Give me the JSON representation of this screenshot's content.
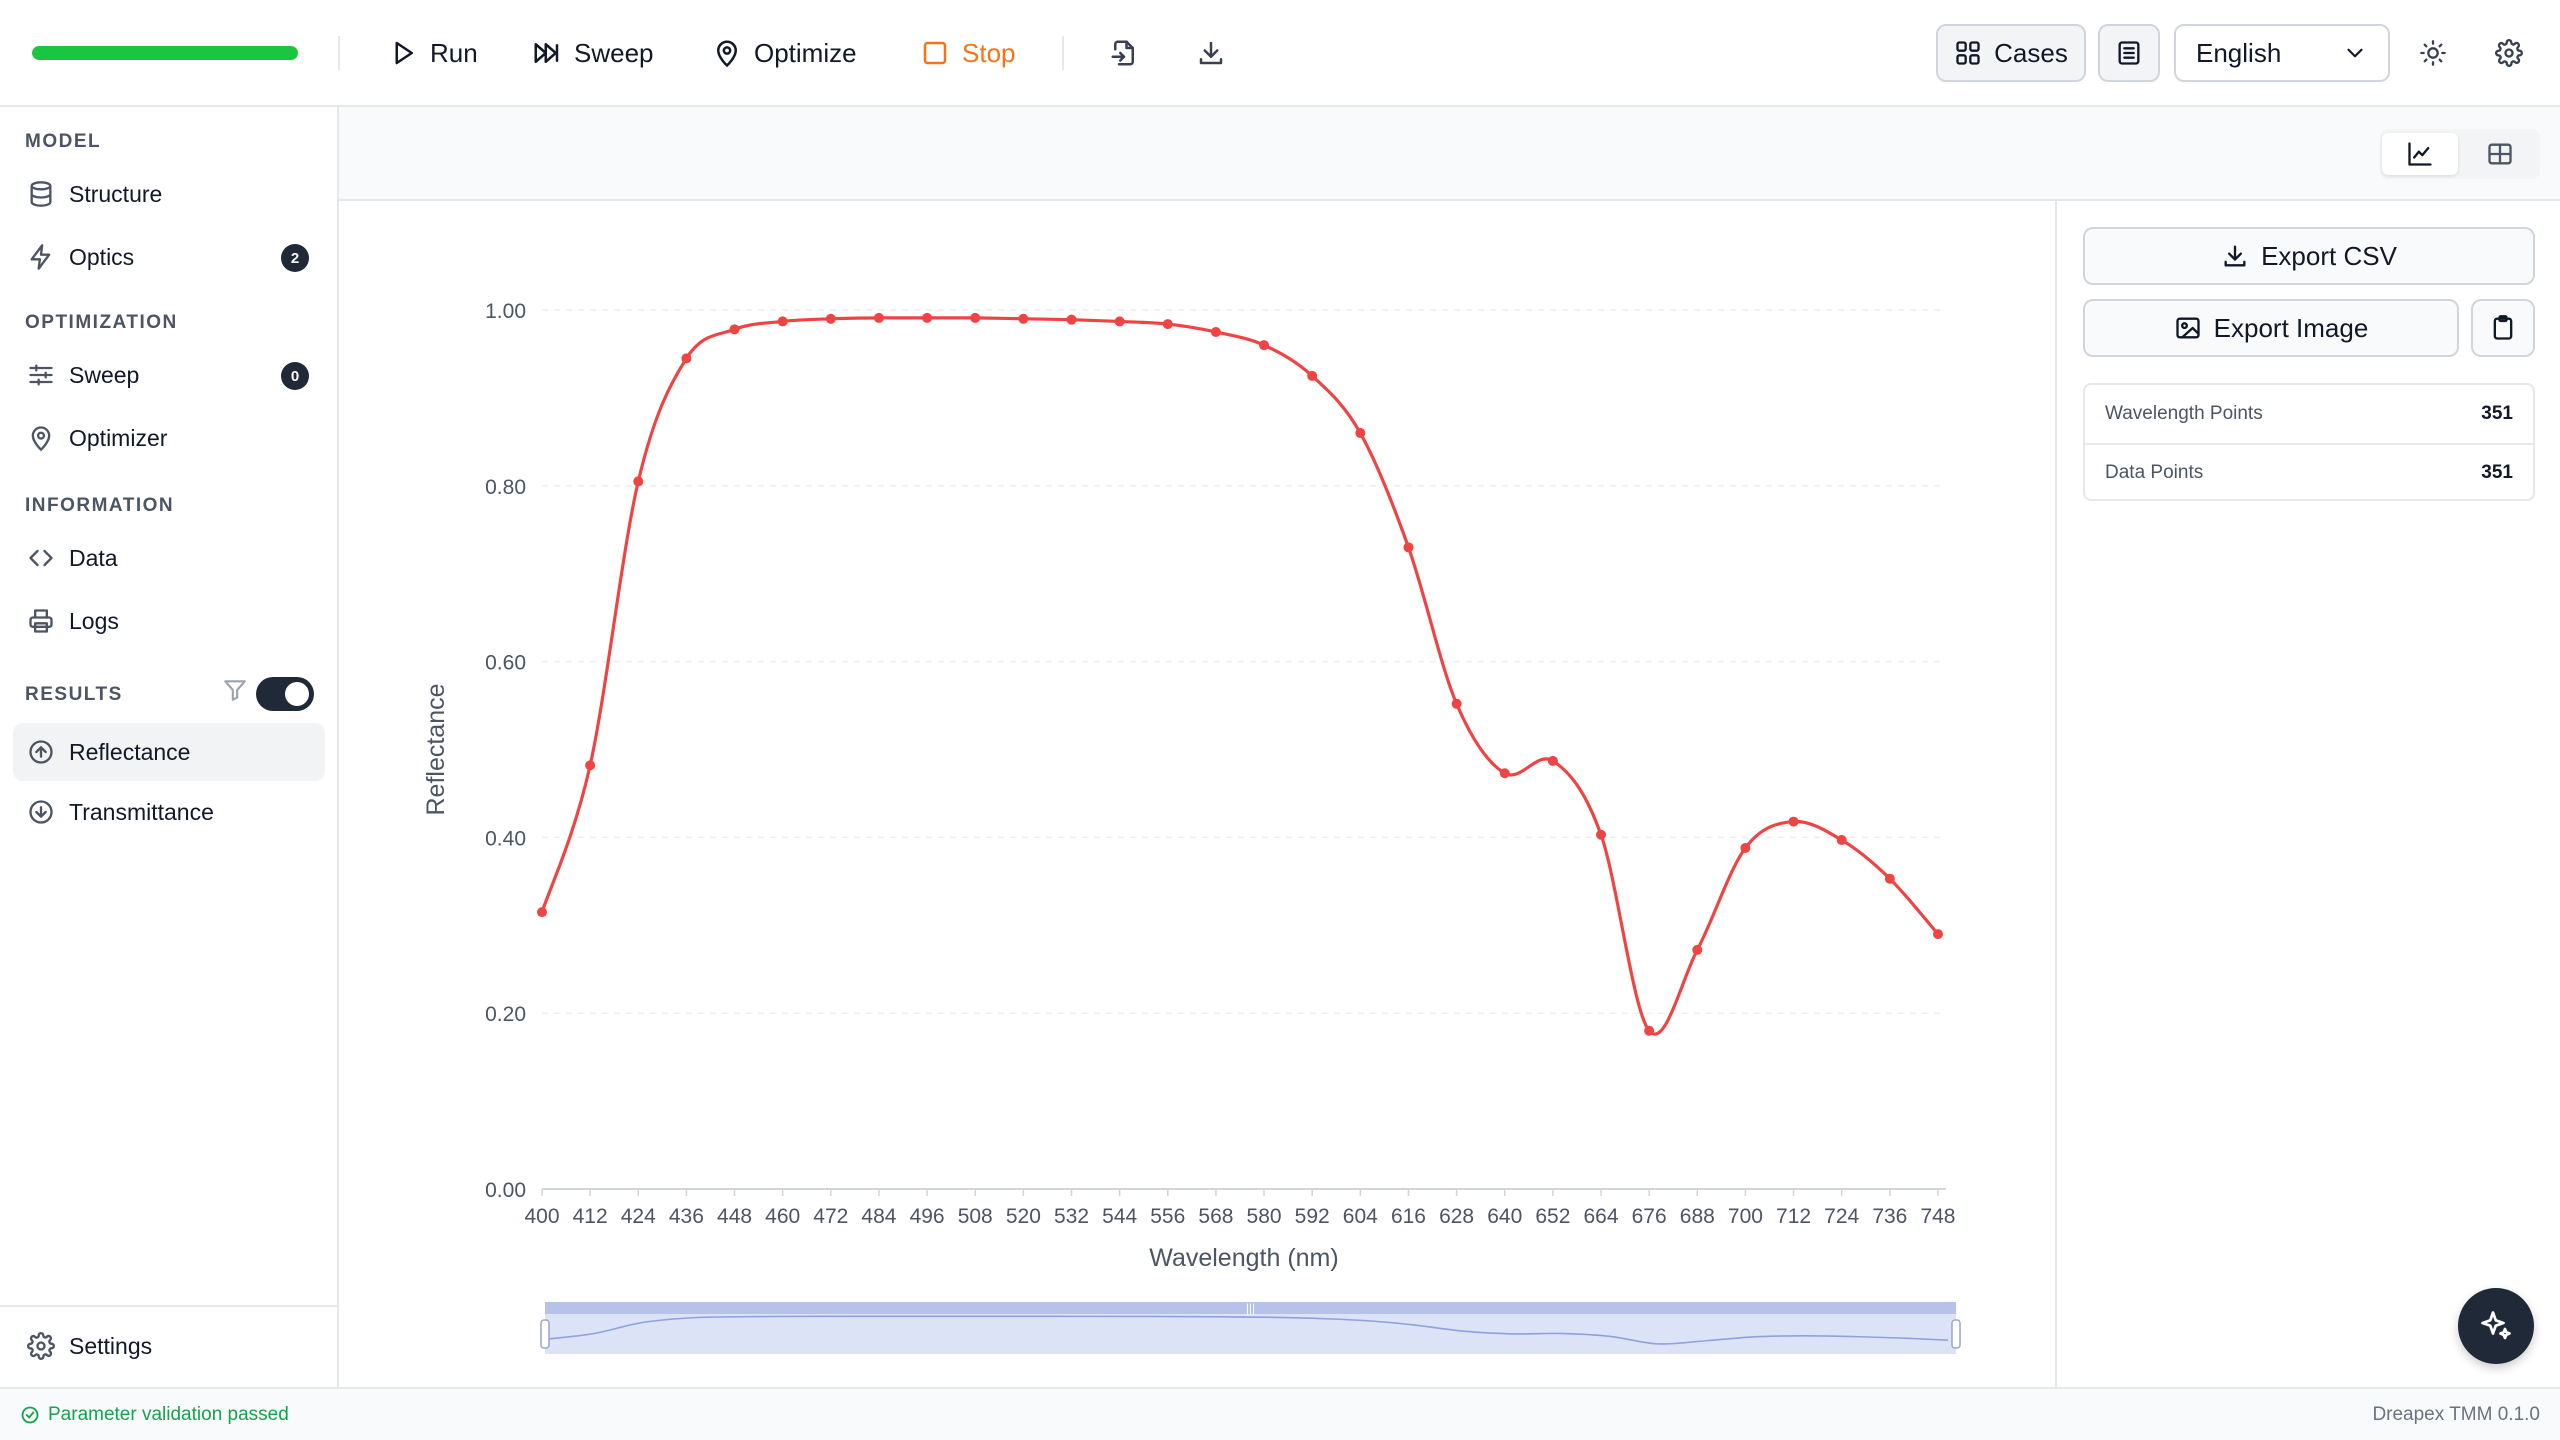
{
  "toolbar": {
    "progress": 1.0,
    "run_label": "Run",
    "sweep_label": "Sweep",
    "optimize_label": "Optimize",
    "stop_label": "Stop",
    "cases_label": "Cases",
    "language": "English"
  },
  "sidebar": {
    "sections": {
      "model": "MODEL",
      "optimization": "OPTIMIZATION",
      "information": "INFORMATION",
      "results": "RESULTS"
    },
    "items": {
      "structure": "Structure",
      "optics": "Optics",
      "optics_badge": "2",
      "sweep": "Sweep",
      "sweep_badge": "0",
      "optimizer": "Optimizer",
      "data": "Data",
      "logs": "Logs",
      "reflectance": "Reflectance",
      "transmittance": "Transmittance",
      "settings": "Settings"
    },
    "results_toggle_on": true
  },
  "right_panel": {
    "export_csv": "Export CSV",
    "export_image": "Export Image",
    "stats": [
      {
        "label": "Wavelength Points",
        "value": "351"
      },
      {
        "label": "Data Points",
        "value": "351"
      }
    ]
  },
  "status": {
    "message": "Parameter validation passed",
    "version": "Dreapex TMM 0.1.0"
  },
  "colors": {
    "progress": "#1ac640",
    "stop": "#f97316",
    "series": "#ef4444",
    "ok": "#16a34a"
  },
  "chart_data": {
    "type": "line",
    "xlabel": "Wavelength (nm)",
    "ylabel": "Reflectance",
    "xlim": [
      400,
      750
    ],
    "ylim": [
      0,
      1.0
    ],
    "yticks": [
      "0.00",
      "0.20",
      "0.40",
      "0.60",
      "0.80",
      "1.00"
    ],
    "xticks": [
      "400",
      "412",
      "424",
      "436",
      "448",
      "460",
      "472",
      "484",
      "496",
      "508",
      "520",
      "532",
      "544",
      "556",
      "568",
      "580",
      "592",
      "604",
      "616",
      "628",
      "640",
      "652",
      "664",
      "676",
      "688",
      "700",
      "712",
      "724",
      "736",
      "748"
    ],
    "grid": true,
    "x": [
      400,
      412,
      424,
      436,
      448,
      460,
      472,
      484,
      496,
      508,
      520,
      532,
      544,
      556,
      568,
      580,
      592,
      604,
      616,
      628,
      640,
      652,
      664,
      676,
      688,
      700,
      712,
      724,
      736,
      748
    ],
    "y": [
      0.315,
      0.482,
      0.805,
      0.945,
      0.978,
      0.987,
      0.99,
      0.991,
      0.991,
      0.991,
      0.99,
      0.989,
      0.987,
      0.984,
      0.975,
      0.96,
      0.925,
      0.86,
      0.73,
      0.552,
      0.473,
      0.487,
      0.403,
      0.18,
      0.272,
      0.388,
      0.418,
      0.397,
      0.353,
      0.29
    ],
    "brush_range": [
      400,
      750
    ]
  }
}
